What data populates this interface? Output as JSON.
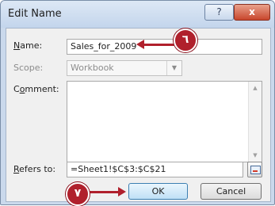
{
  "window": {
    "title": "Edit Name",
    "help_glyph": "?",
    "close_glyph": "x"
  },
  "fields": {
    "name_label_pre": "",
    "name_label_u": "N",
    "name_label_post": "ame:",
    "name_value": "Sales_for_2009",
    "scope_label": "Scope:",
    "scope_value": "Workbook",
    "comment_label_pre": "C",
    "comment_label_u": "o",
    "comment_label_post": "mment:",
    "comment_value": "",
    "refers_label_pre": "",
    "refers_label_u": "R",
    "refers_label_post": "efers to:",
    "refers_value": "=Sheet1!$C$3:$C$21"
  },
  "buttons": {
    "ok": "OK",
    "cancel": "Cancel"
  },
  "callouts": {
    "step6": "٦",
    "step7": "٧"
  },
  "colors": {
    "accent": "#b0202c"
  }
}
